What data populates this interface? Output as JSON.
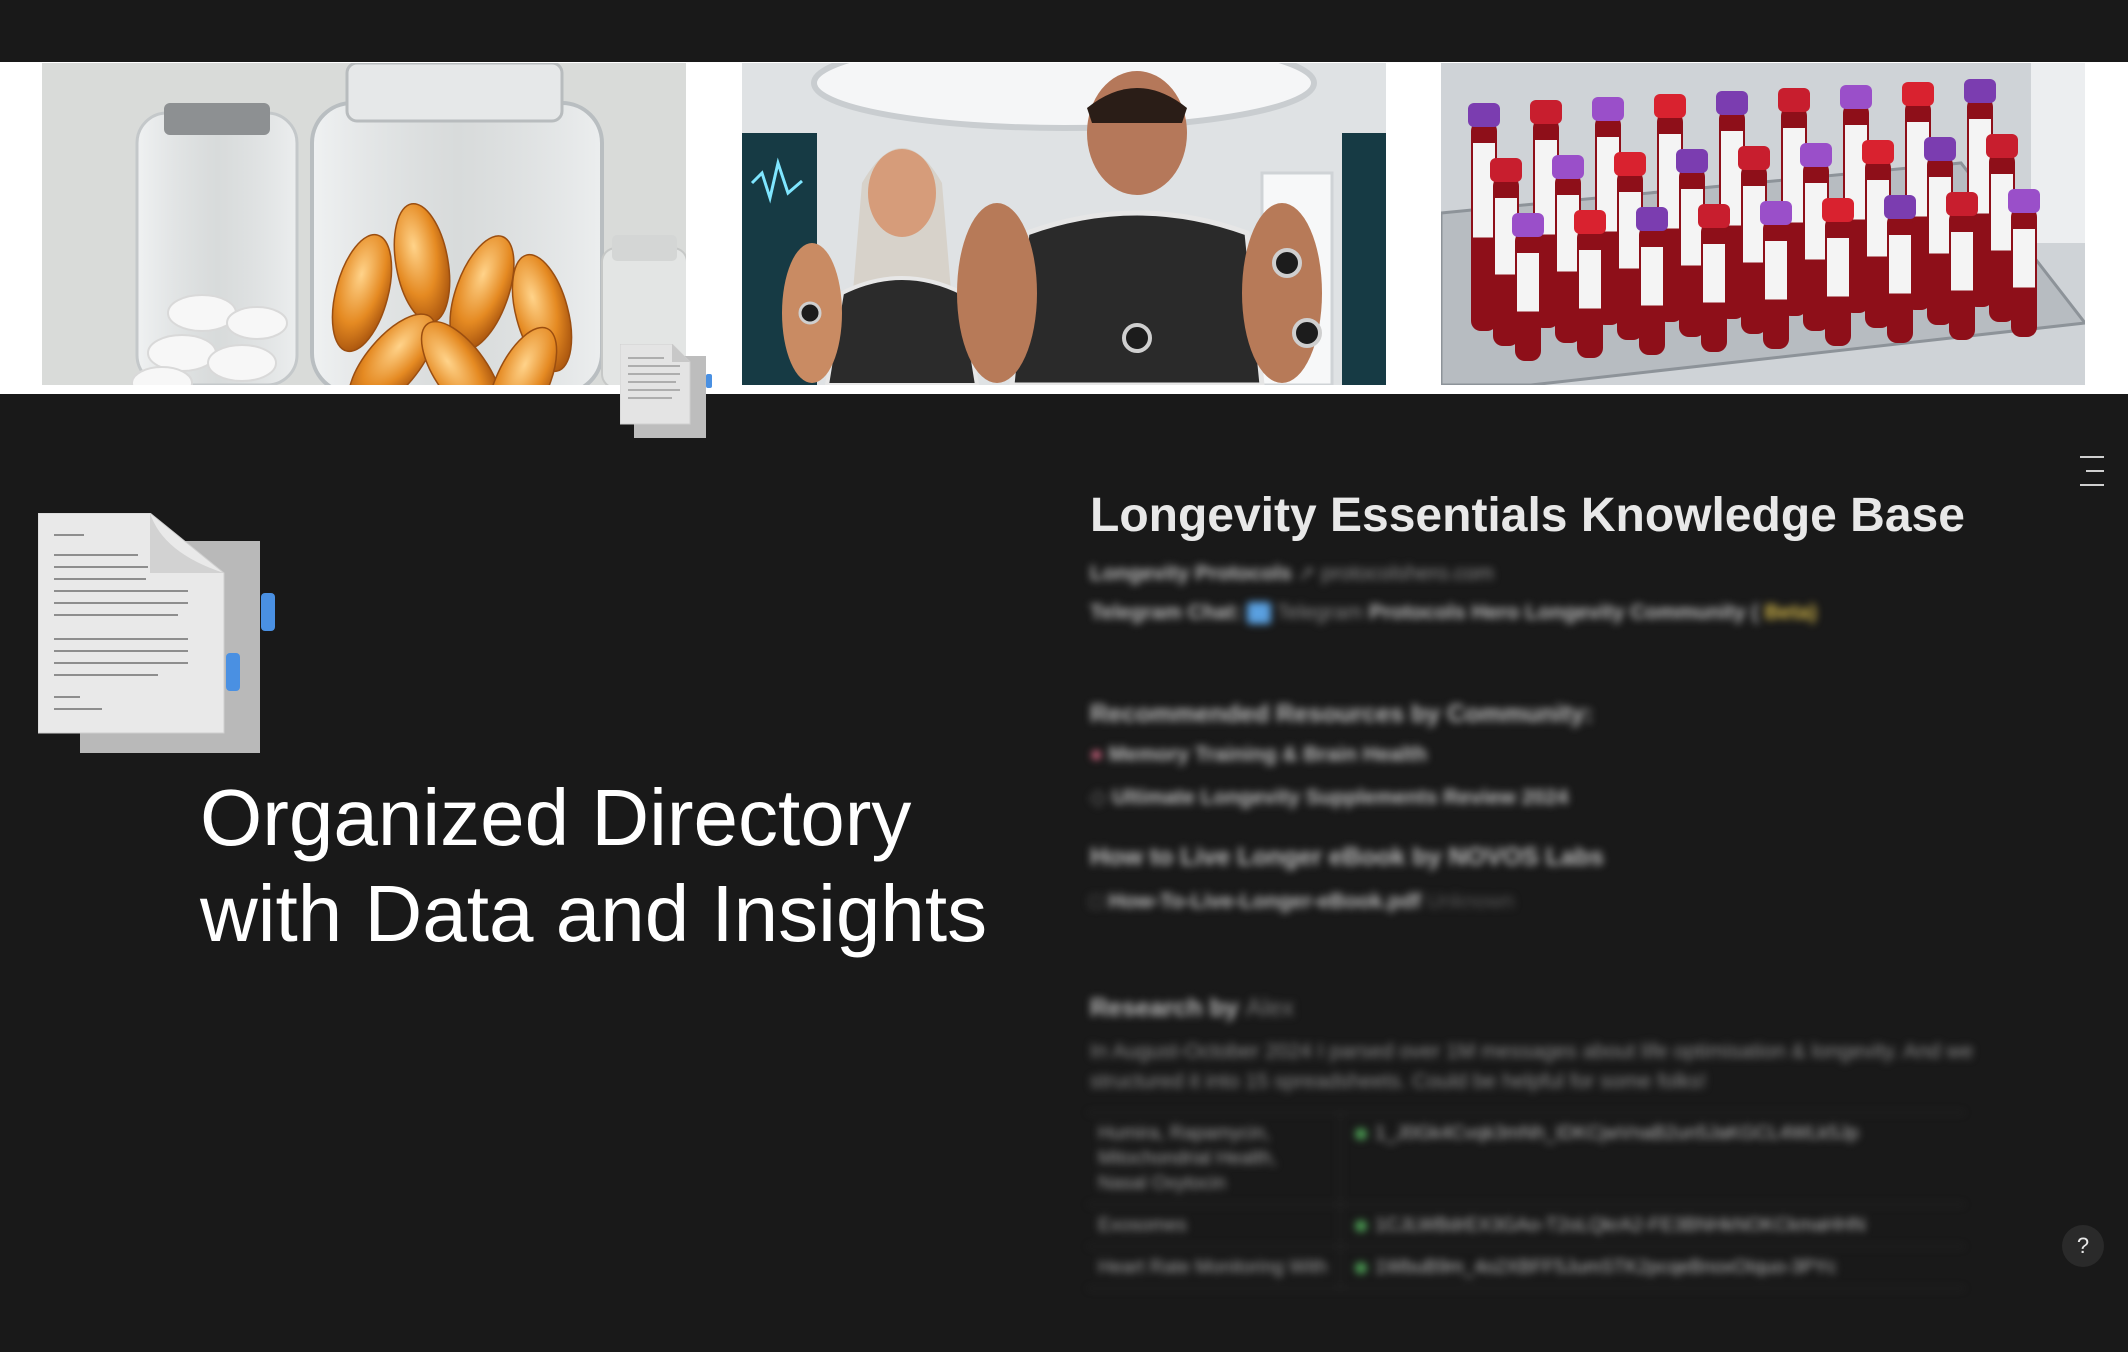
{
  "banner": {
    "photos": [
      {
        "subject": "supplement-jars"
      },
      {
        "subject": "biohacker-figures"
      },
      {
        "subject": "blood-sample-tubes"
      }
    ]
  },
  "headline": {
    "line1": "Organized Directory",
    "line2": "with Data and Insights"
  },
  "knowledge_base": {
    "title": "Longevity Essentials Knowledge Base",
    "protocols_label": "Longevity Protocols",
    "protocols_link": "protocolshero.com",
    "telegram_label": "Telegram Chat:",
    "telegram_icon_text": "Telegram",
    "telegram_link": "Protocols Hero Longevity Community (",
    "telegram_beta": "Beta)",
    "recommended_heading": "Recommended Resources by Community:",
    "resources": [
      {
        "icon": "brain-icon",
        "label": "Memory Training & Brain Health"
      },
      {
        "icon": "pill-icon",
        "label": "Ultimate Longevity Supplements Review 2024"
      }
    ],
    "ebook_heading": "How to Live Longer eBook by NOVOS Labs",
    "ebook_file": "How-To-Live-Longer-eBook.pdf",
    "ebook_size": "Unknown",
    "research_heading": "Research by",
    "research_author": "Alex",
    "research_text_1": "In August-October 2024 I parsed over 1M messages about life optimisation & longevity. And we",
    "research_text_2": "structured it into 15 spreadsheets. Could be helpful for some folks!",
    "table": [
      {
        "topic": "Humira, Rapamycin, Mitochondrial Health, Nasal Oxytocin",
        "sheet": "1_J0Gk4Cvqk3mNh_IDKCjwVnaB2un5JaKGCL4WLk5Jp"
      },
      {
        "topic": "Exosomes",
        "sheet": "1CJLWBdrEX3GAo-T2oLQkrA2-FE3BNHkNOKCkmaHHN"
      },
      {
        "topic": "Heart Rate Monitoring With",
        "sheet": "1WbuB9m_4o2XBFF5JumSTK2pcqeBnoxOIquo-3PYc"
      }
    ]
  },
  "controls": {
    "help_label": "?"
  },
  "colors": {
    "background": "#191919",
    "banner_frame": "#ffffff",
    "accent_blue": "#4a90e2"
  }
}
